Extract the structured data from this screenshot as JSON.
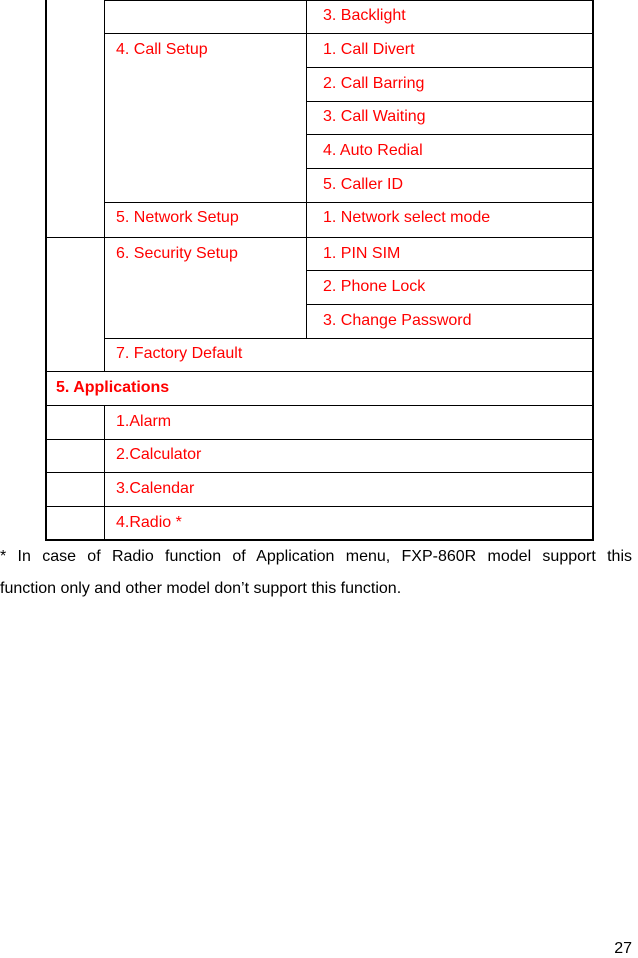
{
  "table": {
    "rows": [
      {
        "col3": "3. Backlight"
      },
      {
        "col2": "4. Call Setup",
        "col3": "1. Call Divert"
      },
      {
        "col3": "2. Call Barring"
      },
      {
        "col3": "3. Call Waiting"
      },
      {
        "col3": "4. Auto Redial"
      },
      {
        "col3": "5. Caller ID"
      },
      {
        "col2": "5. Network Setup",
        "col3": "1. Network select mode"
      },
      {
        "col2": "6. Security Setup",
        "col3": "1. PIN SIM"
      },
      {
        "col3": "2. Phone Lock"
      },
      {
        "col3": "3. Change Password"
      },
      {
        "col2": "7. Factory Default"
      }
    ],
    "section_header": "5. Applications",
    "applications": [
      "1.Alarm",
      "2.Calculator",
      "3.Calendar",
      "4.Radio *"
    ]
  },
  "footnote": {
    "line1": "* In case of Radio function of Application menu, FXP-860R model support this",
    "line2": "function only and other model don’t support this function."
  },
  "page_number": "27",
  "colors": {
    "menu_text": "#ff0000",
    "border": "#000000"
  }
}
